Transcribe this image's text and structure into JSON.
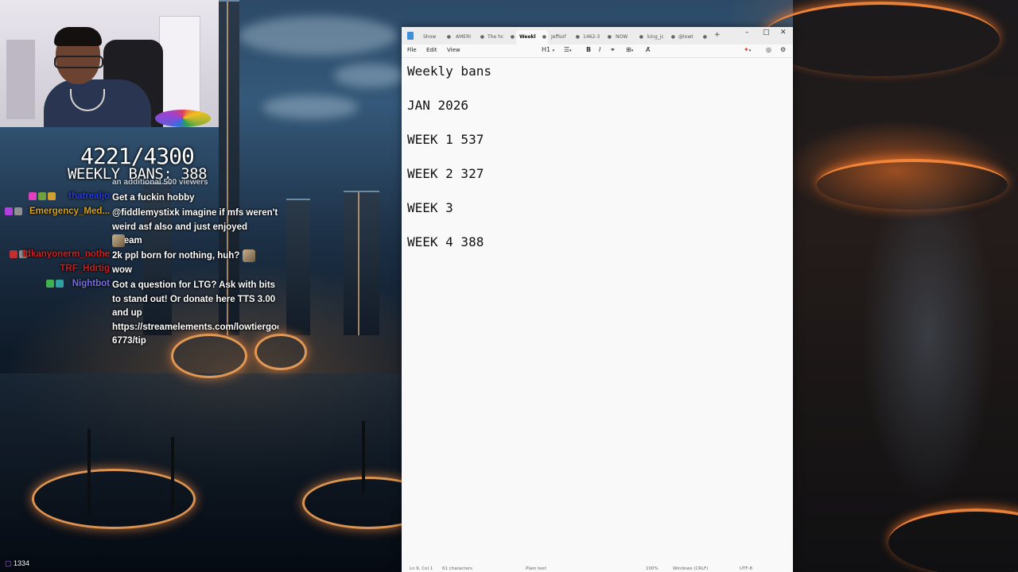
{
  "overlay": {
    "count": "4221/4300",
    "weekly_bans": "WEEKLY BANS: 388",
    "viewer_count": "1334"
  },
  "chat": {
    "partial_top": "an additional 500 viewers",
    "messages": [
      {
        "user": "thatrealjo",
        "user_color": "#2a3fd8",
        "text": "Get a fuckin hobby"
      },
      {
        "user": "Emergency_Med...",
        "user_color": "#d6a21e",
        "text": "@fiddlemystixk imagine if mfs weren't weird asf also and just enjoyed stream"
      },
      {
        "user": "ldkanyonerm_nothe",
        "user_color": "#d02020",
        "text": "2k ppl born for nothing, huh?"
      },
      {
        "user": "TRF_Hdrtig",
        "user_color": "#c02020",
        "text": "wow"
      },
      {
        "user": "Nightbot",
        "user_color": "#7a6fe0",
        "text": "Got a question for LTG? Ask with bits to stand out! Or donate here TTS 3.00 and up https://streamelements.com/lowtiergod-6773/tip"
      }
    ]
  },
  "notepad": {
    "tabs": [
      "Show",
      "AMERI",
      "The hc",
      "Weekl",
      "Jeffsof",
      "1462-3",
      "NOW",
      "king_jc",
      "@lowt"
    ],
    "active_tab": "Weekl",
    "menu": {
      "file": "File",
      "edit": "Edit",
      "view": "View"
    },
    "toolbar": {
      "heading": "H1",
      "bold": "B",
      "italic": "I"
    },
    "lines": [
      "Weekly bans",
      "JAN 2026",
      "WEEK 1 537",
      "WEEK 2 327",
      "WEEK 3",
      "WEEK 4 388"
    ],
    "status": {
      "position": "Ln 6, Col 1",
      "characters": "61 characters",
      "format": "Plain text",
      "zoom": "100%",
      "line_ending": "Windows (CRLF)",
      "encoding": "UTF-8"
    }
  }
}
